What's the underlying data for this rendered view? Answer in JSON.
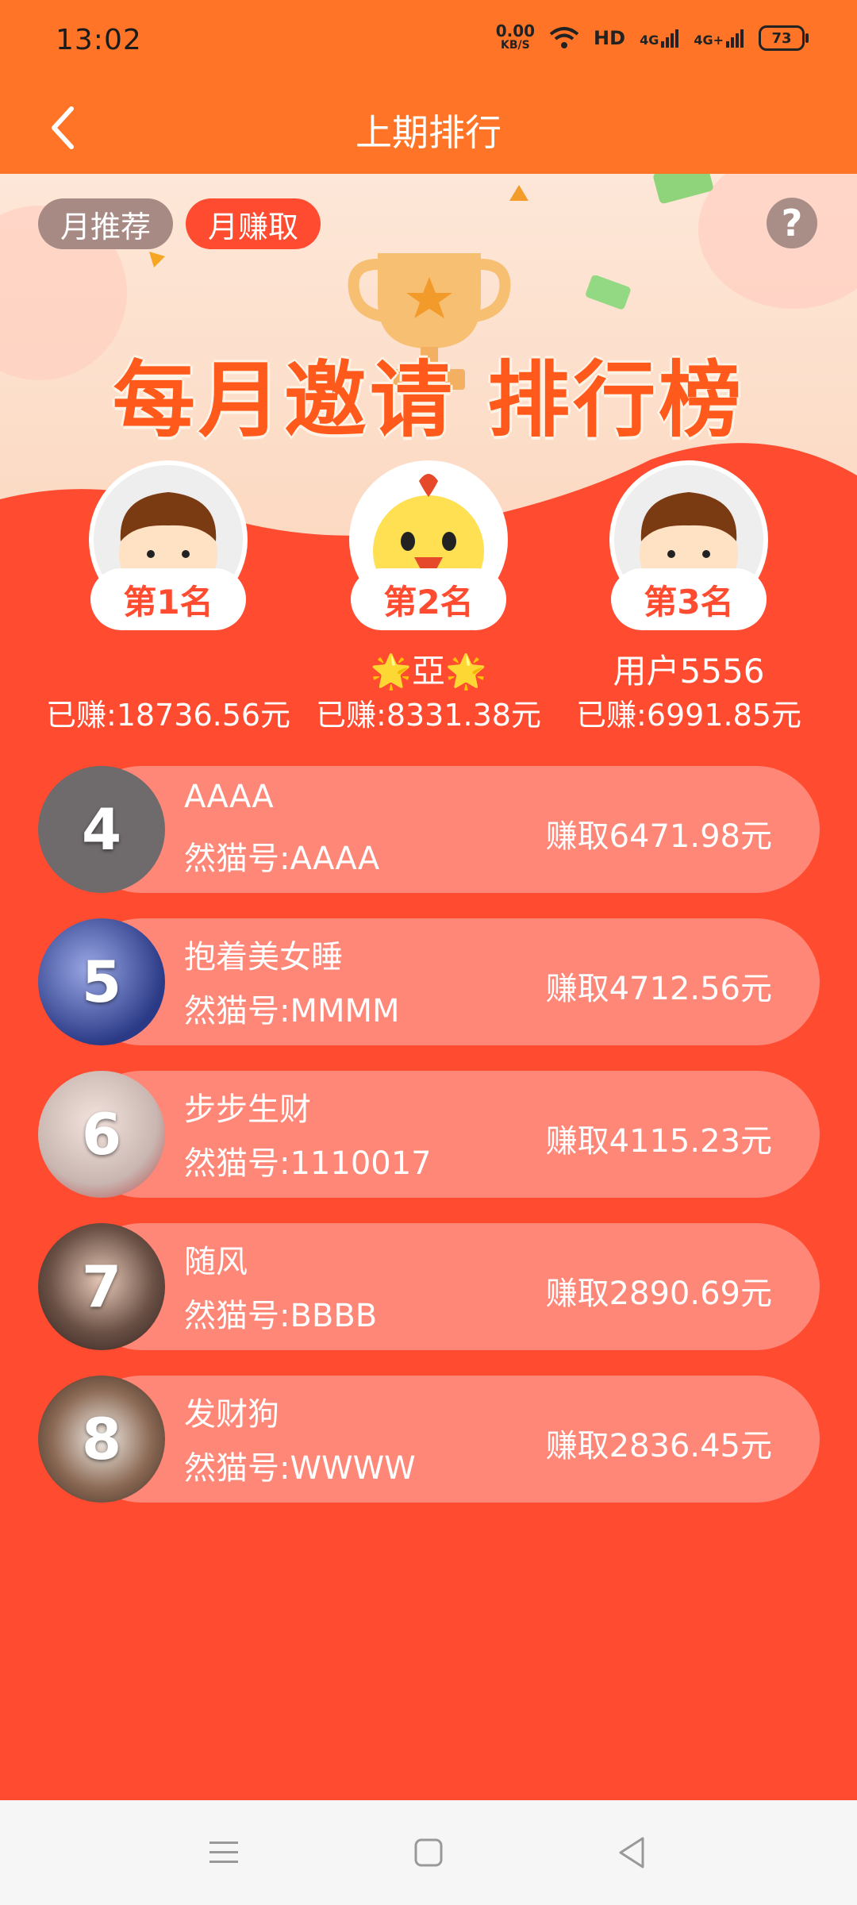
{
  "status_bar": {
    "time": "13:02",
    "net_speed_value": "0.00",
    "net_speed_unit": "KB/S",
    "hd_label": "HD",
    "signal1_label": "4G",
    "signal2_label": "4G+",
    "battery": "73"
  },
  "header": {
    "title": "上期排行",
    "back_icon": "chevron-left-icon"
  },
  "hero": {
    "tabs": [
      {
        "label": "月推荐",
        "active": false
      },
      {
        "label": "月赚取",
        "active": true
      }
    ],
    "help_label": "?",
    "banner_title": "每月邀请 排行榜"
  },
  "podium": [
    {
      "rank_label": "第1名",
      "name": "",
      "earned": "已赚:18736.56元",
      "avatar": "boy-avatar"
    },
    {
      "rank_label": "第2名",
      "name": "🌟亞🌟",
      "earned": "已赚:8331.38元",
      "avatar": "chick-avatar"
    },
    {
      "rank_label": "第3名",
      "name": "用户5556",
      "earned": "已赚:6991.85元",
      "avatar": "boy-avatar"
    }
  ],
  "ranking_list": [
    {
      "rank": "4",
      "name": "AAAA",
      "id": "然猫号:AAAA",
      "amount": "赚取6471.98元",
      "avatar_color": "#6f6a6c"
    },
    {
      "rank": "5",
      "name": "抱着美女睡",
      "id": "然猫号:MMMM",
      "amount": "赚取4712.56元",
      "avatar_color": "#2b3a86"
    },
    {
      "rank": "6",
      "name": "步步生财",
      "id": "然猫号:1110017",
      "amount": "赚取4115.23元",
      "avatar_color": "#c9b6b1"
    },
    {
      "rank": "7",
      "name": "随风",
      "id": "然猫号:BBBB",
      "amount": "赚取2890.69元",
      "avatar_color": "#3a2a26"
    },
    {
      "rank": "8",
      "name": "发财狗",
      "id": "然猫号:WWWW",
      "amount": "赚取2836.45元",
      "avatar_color": "#6b4a3a"
    }
  ],
  "nav_bar": {
    "menu_icon": "menu-icon",
    "home_icon": "home-square-icon",
    "back_icon": "back-triangle-icon"
  },
  "colors": {
    "primary_orange": "#ff7426",
    "page_red": "#ff4b2f",
    "row_pink": "#ff8777"
  }
}
